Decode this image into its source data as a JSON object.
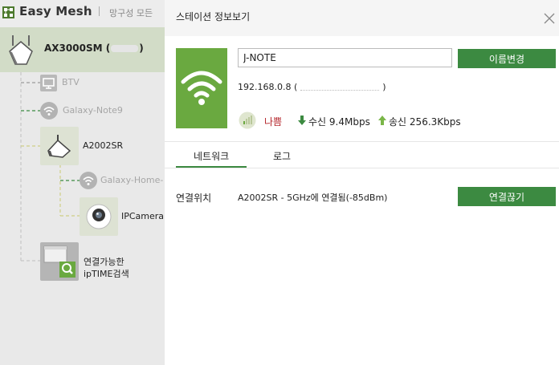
{
  "app": {
    "title": "Easy Mesh",
    "hint": "망구성 모든"
  },
  "topology": {
    "root": {
      "label": "AX3000SM (",
      "label_suffix": ")"
    },
    "nodes": {
      "btv": {
        "label": "BTV"
      },
      "note9": {
        "label": "Galaxy-Note9"
      },
      "a2002sr": {
        "label": "A2002SR"
      },
      "galaxy_home": {
        "label": "Galaxy-Home-"
      },
      "ipcamera": {
        "label": "IPCamera"
      },
      "search": {
        "line1": "연결가능한",
        "line2": "ipTIME검색"
      }
    }
  },
  "dialog": {
    "title": "스테이션 정보보기",
    "device_name": "J-NOTE",
    "rename_label": "이름변경",
    "ip": "192.168.0.8 (",
    "ip_close": ")",
    "signal": "나쁨",
    "rx_label": "수신",
    "rx_value": "9.4Mbps",
    "tx_label": "송신",
    "tx_value": "256.3Kbps",
    "tabs": [
      "네트워크",
      "로그"
    ],
    "location_label": "연결위치",
    "location_value": "A2002SR - 5GHz에 연결됨(-85dBm)",
    "disconnect_label": "연결끊기"
  },
  "colors": {
    "accent": "#3c8a41",
    "wifi_tile": "#6aa940",
    "signal_bad": "#b5272c",
    "selected_row": "#d2dcc7"
  }
}
